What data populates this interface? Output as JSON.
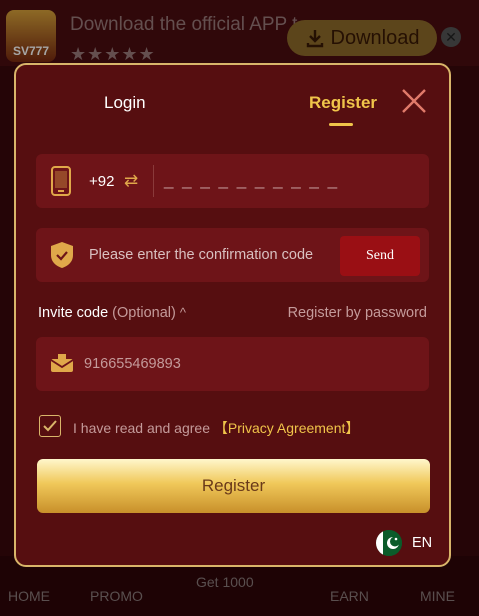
{
  "banner": {
    "logo_text": "SV777",
    "text": "Download the official APP t...",
    "stars": "★★★★★",
    "download_label": "Download"
  },
  "bottom_nav": [
    "HOME",
    "PROMO",
    "Get 1000",
    "EARN",
    "MINE"
  ],
  "modal": {
    "tabs": {
      "login": "Login",
      "register": "Register"
    },
    "phone": {
      "country_code": "+92",
      "placeholder": "_ _ _ _ _ _ _ _ _ _"
    },
    "code": {
      "placeholder": "Please enter the confirmation code",
      "send_label": "Send"
    },
    "invite": {
      "label": "Invite code",
      "optional": "(Optional)",
      "value": "916655469893"
    },
    "register_by_password": "Register by password",
    "agreement": {
      "text": "I have read and agree",
      "link": "【Privacy Agreement】",
      "checked": true
    },
    "register_button": "Register",
    "language": "EN"
  },
  "colors": {
    "accent": "#f0c44a",
    "modal_bg": "#560e10",
    "field_bg": "#6e1418"
  }
}
